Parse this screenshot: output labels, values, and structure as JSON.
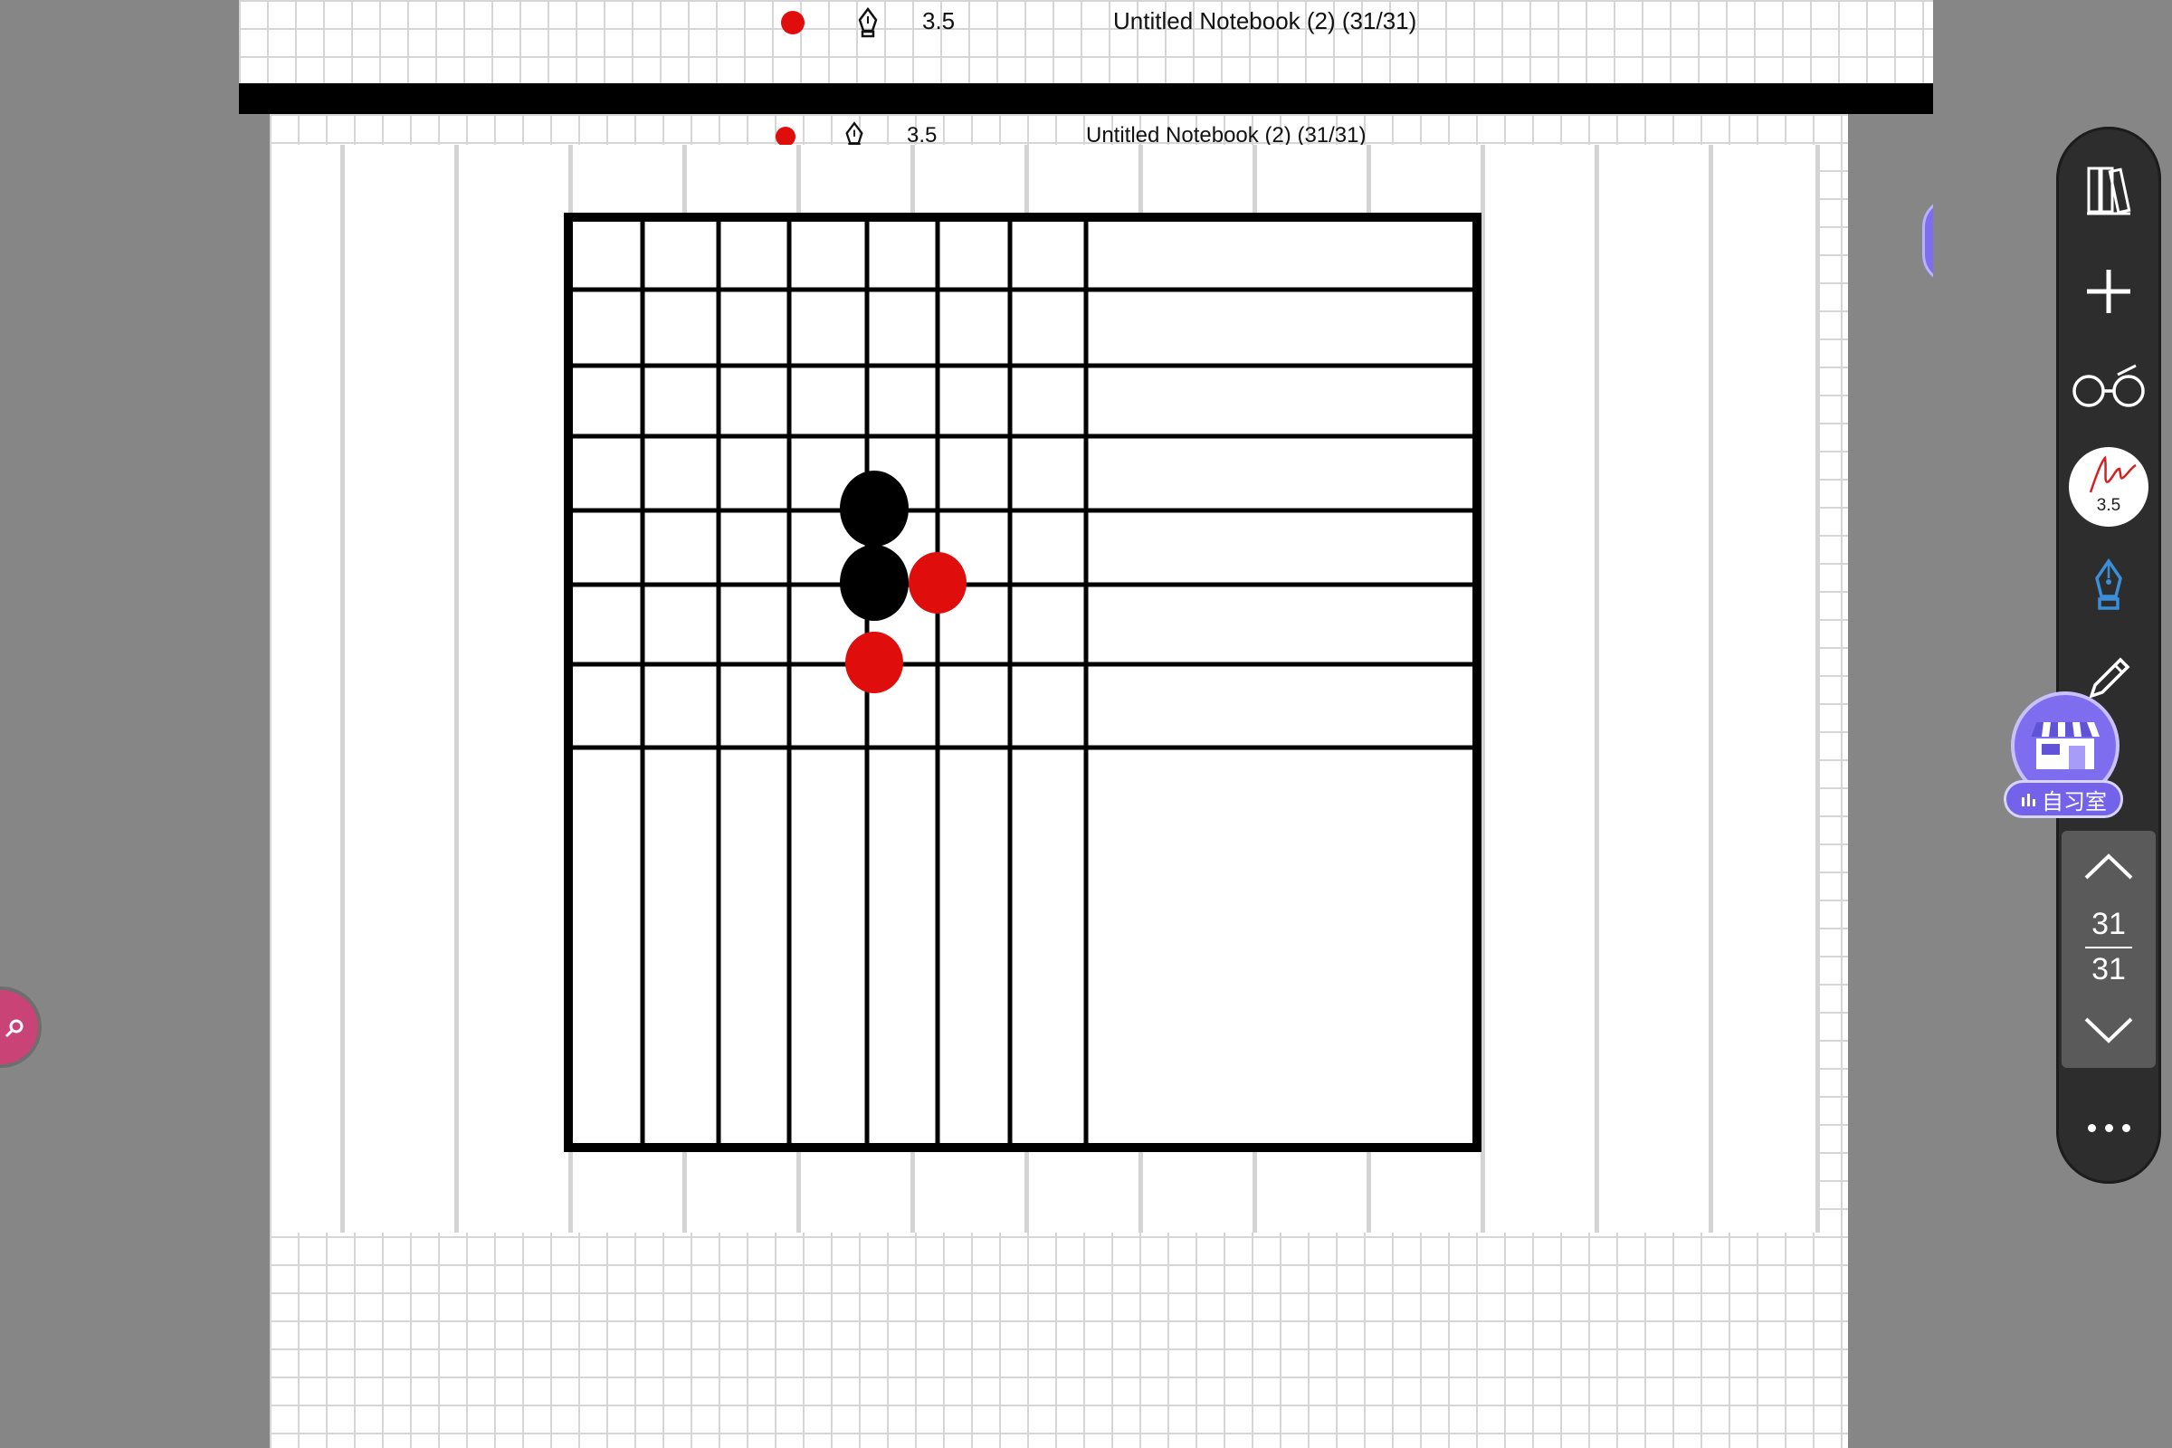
{
  "status_bar": {
    "pen_size": "3.5",
    "notebook_title": "Untitled Notebook (2) (31/31)"
  },
  "toolbar": {
    "pen_size": "3.5",
    "page_current": "31",
    "page_total": "31",
    "active_tool": "fountain-pen"
  },
  "study_room": {
    "label": "自习室"
  },
  "colors": {
    "ink_red": "#e00d0d",
    "ink_black": "#000000",
    "toolbar_bg": "#2d2d2d",
    "accent_blue": "#3a8fd8",
    "study_purple": "#7263ea"
  },
  "board": {
    "columns": 8,
    "rows": 8,
    "stones": [
      {
        "color": "black",
        "col": 4,
        "row": 4
      },
      {
        "color": "black",
        "col": 4,
        "row": 5
      },
      {
        "color": "red",
        "col": 5,
        "row": 5
      },
      {
        "color": "red",
        "col": 4,
        "row": 6
      }
    ]
  }
}
